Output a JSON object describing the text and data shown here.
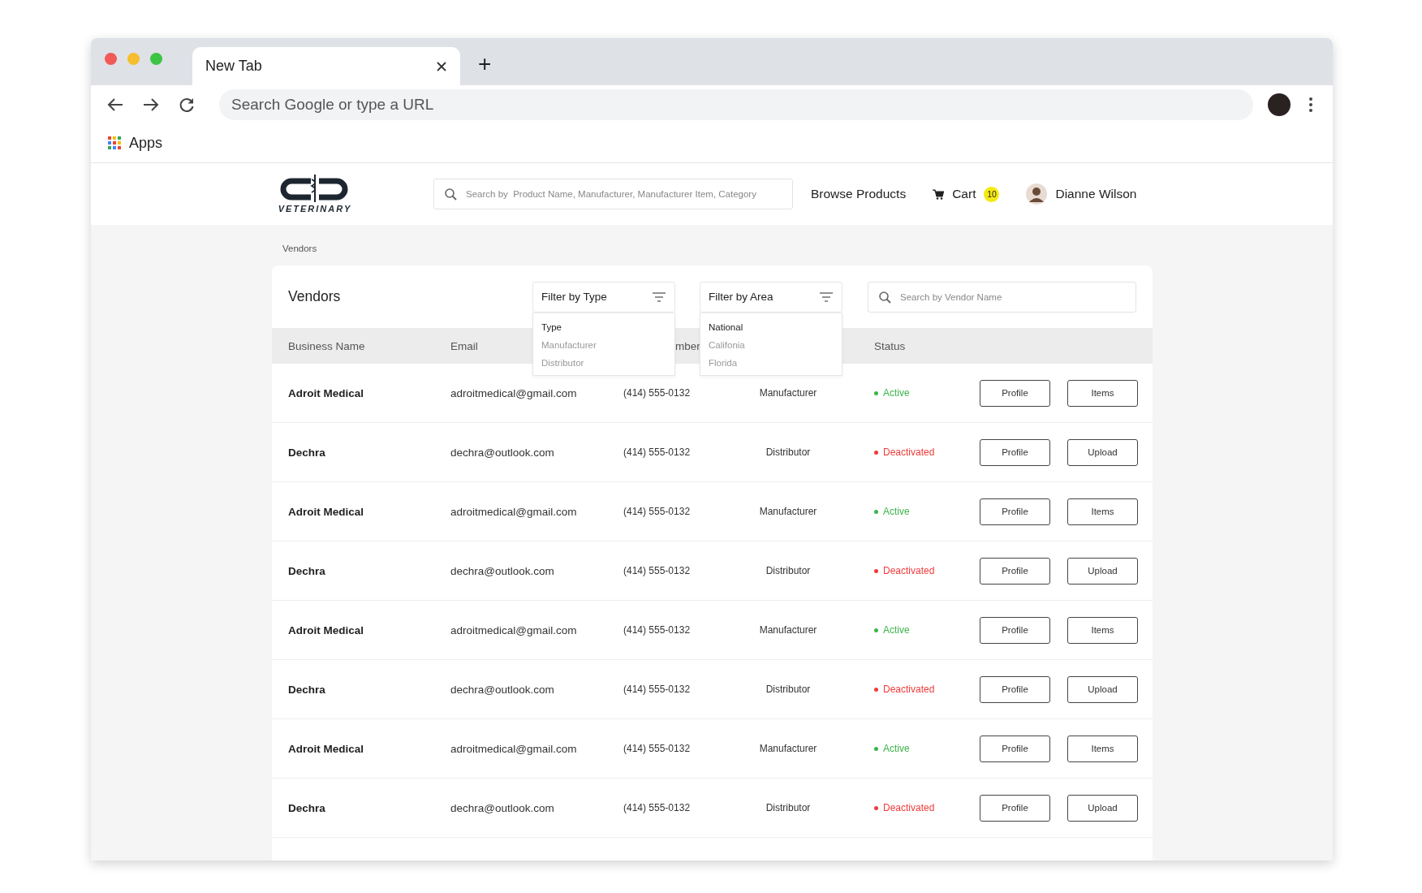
{
  "browser": {
    "tab": {
      "title": "New Tab"
    },
    "new_tab": "+",
    "address_placeholder": "Search Google or type a URL",
    "bookmarks": [
      {
        "label": "Apps"
      }
    ]
  },
  "header": {
    "logo_text": "VETERINARY",
    "search_placeholder": "Search by  Product Name, Manufacturer, Manufacturer Item, Category",
    "nav": [
      {
        "label": "Browse Products"
      }
    ],
    "cart": {
      "label": "Cart",
      "count": "10"
    },
    "user": {
      "name": "Dianne Wilson"
    }
  },
  "breadcrumb": "Vendors",
  "vendors": {
    "title": "Vendors",
    "filters": [
      {
        "label": "Filter by Type",
        "options": [
          {
            "label": "Type",
            "selected": true
          },
          {
            "label": "Manufacturer",
            "selected": false
          },
          {
            "label": "Distributor",
            "selected": false
          }
        ]
      },
      {
        "label": "Filter by Area",
        "options": [
          {
            "label": "National",
            "selected": true
          },
          {
            "label": "Califonia",
            "selected": false
          },
          {
            "label": "Florida",
            "selected": false
          }
        ]
      }
    ],
    "search_placeholder": "Search by Vendor Name",
    "columns": [
      {
        "kind": "name",
        "label": "Business Name"
      },
      {
        "kind": "email",
        "label": "Email"
      },
      {
        "kind": "phone",
        "label": "mber"
      },
      {
        "kind": "status",
        "label": "Status"
      }
    ],
    "rows": [
      {
        "name": "Adroit Medical",
        "email": "adroitmedical@gmail.com",
        "phone": "(414) 555-0132",
        "type": "Manufacturer",
        "status": "Active",
        "color": "#3bb54a",
        "actions": [
          "Profile",
          "Items"
        ]
      },
      {
        "name": "Dechra",
        "email": "dechra@outlook.com",
        "phone": "(414) 555-0132",
        "type": "Distributor",
        "status": "Deactivated",
        "color": "#f03a3a",
        "actions": [
          "Profile",
          "Upload"
        ]
      },
      {
        "name": "Adroit Medical",
        "email": "adroitmedical@gmail.com",
        "phone": "(414) 555-0132",
        "type": "Manufacturer",
        "status": "Active",
        "color": "#3bb54a",
        "actions": [
          "Profile",
          "Items"
        ]
      },
      {
        "name": "Dechra",
        "email": "dechra@outlook.com",
        "phone": "(414) 555-0132",
        "type": "Distributor",
        "status": "Deactivated",
        "color": "#f03a3a",
        "actions": [
          "Profile",
          "Upload"
        ]
      },
      {
        "name": "Adroit Medical",
        "email": "adroitmedical@gmail.com",
        "phone": "(414) 555-0132",
        "type": "Manufacturer",
        "status": "Active",
        "color": "#3bb54a",
        "actions": [
          "Profile",
          "Items"
        ]
      },
      {
        "name": "Dechra",
        "email": "dechra@outlook.com",
        "phone": "(414) 555-0132",
        "type": "Distributor",
        "status": "Deactivated",
        "color": "#f03a3a",
        "actions": [
          "Profile",
          "Upload"
        ]
      },
      {
        "name": "Adroit Medical",
        "email": "adroitmedical@gmail.com",
        "phone": "(414) 555-0132",
        "type": "Manufacturer",
        "status": "Active",
        "color": "#3bb54a",
        "actions": [
          "Profile",
          "Items"
        ]
      },
      {
        "name": "Dechra",
        "email": "dechra@outlook.com",
        "phone": "(414) 555-0132",
        "type": "Distributor",
        "status": "Deactivated",
        "color": "#f03a3a",
        "actions": [
          "Profile",
          "Upload"
        ]
      }
    ]
  }
}
